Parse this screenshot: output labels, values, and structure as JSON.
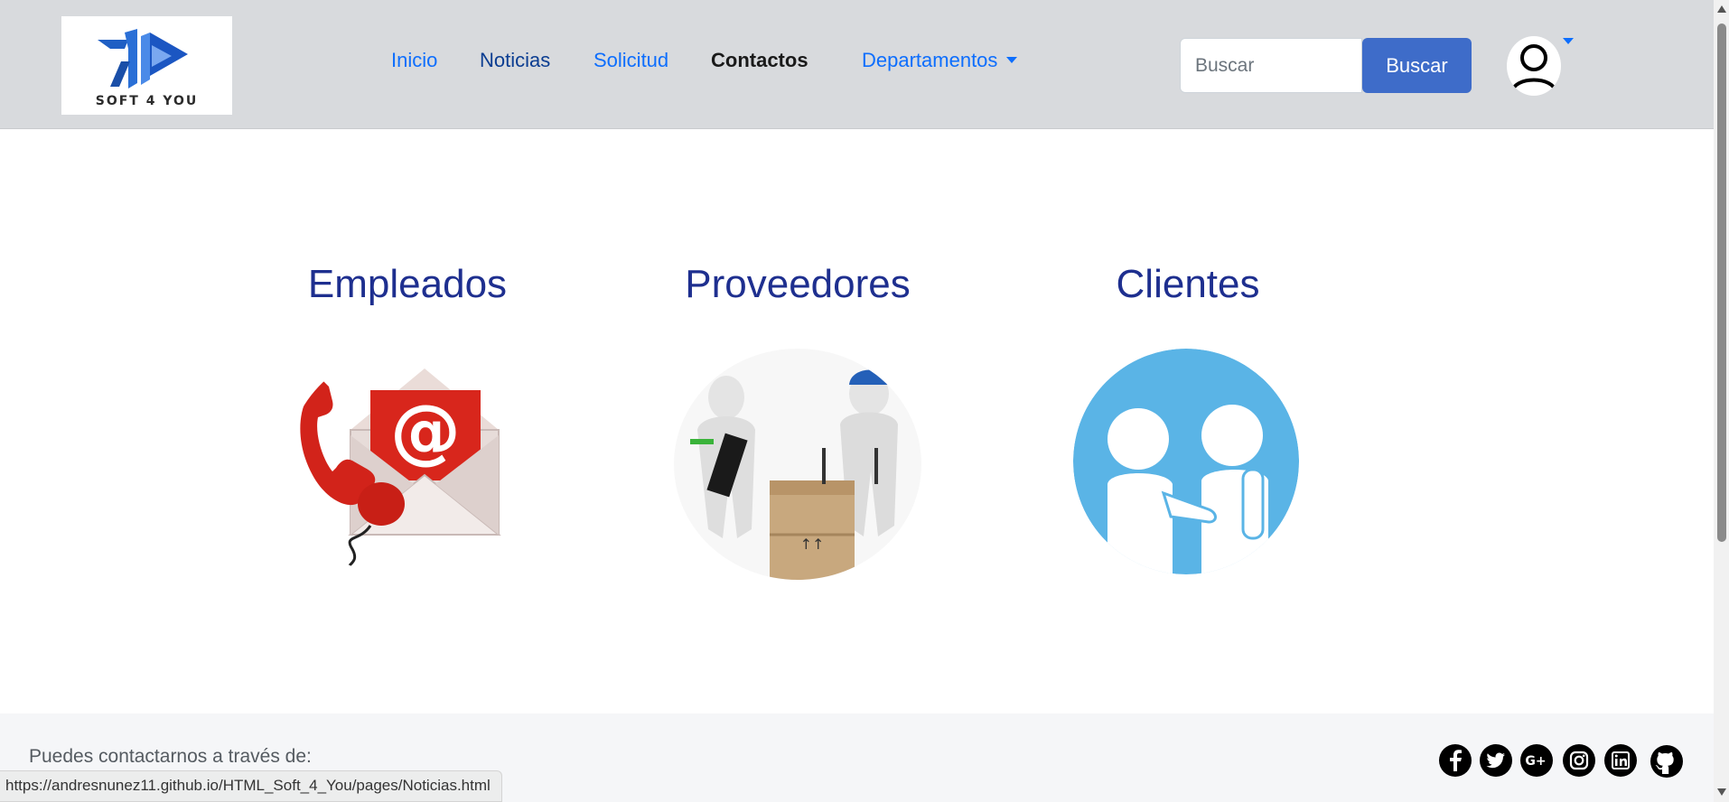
{
  "header": {
    "logo_text": "SOFT 4 YOU",
    "nav": [
      {
        "label": "Inicio"
      },
      {
        "label": "Noticias"
      },
      {
        "label": "Solicitud"
      },
      {
        "label": "Contactos"
      },
      {
        "label": "Departamentos"
      }
    ],
    "active_nav": "Contactos",
    "search": {
      "placeholder": "Buscar",
      "value": "",
      "button_label": "Buscar"
    },
    "user_icon": "user-icon"
  },
  "main": {
    "cards": [
      {
        "title": "Empleados",
        "image": "phone-email-icon"
      },
      {
        "title": "Proveedores",
        "image": "supplier-delivery-icon"
      },
      {
        "title": "Clientes",
        "image": "handshake-icon"
      }
    ]
  },
  "footer": {
    "text": "Puedes contactarnos a través de:",
    "social": [
      "facebook-icon",
      "twitter-icon",
      "google-plus-icon",
      "instagram-icon",
      "linkedin-icon",
      "github-icon"
    ]
  },
  "status_bar": {
    "url": "https://andresnunez11.github.io/HTML_Soft_4_You/pages/Noticias.html"
  },
  "colors": {
    "accent": "#3e6cc9",
    "nav_link": "#0d6efd",
    "title": "#1e2f8f",
    "header_bg": "#d8dadd"
  }
}
